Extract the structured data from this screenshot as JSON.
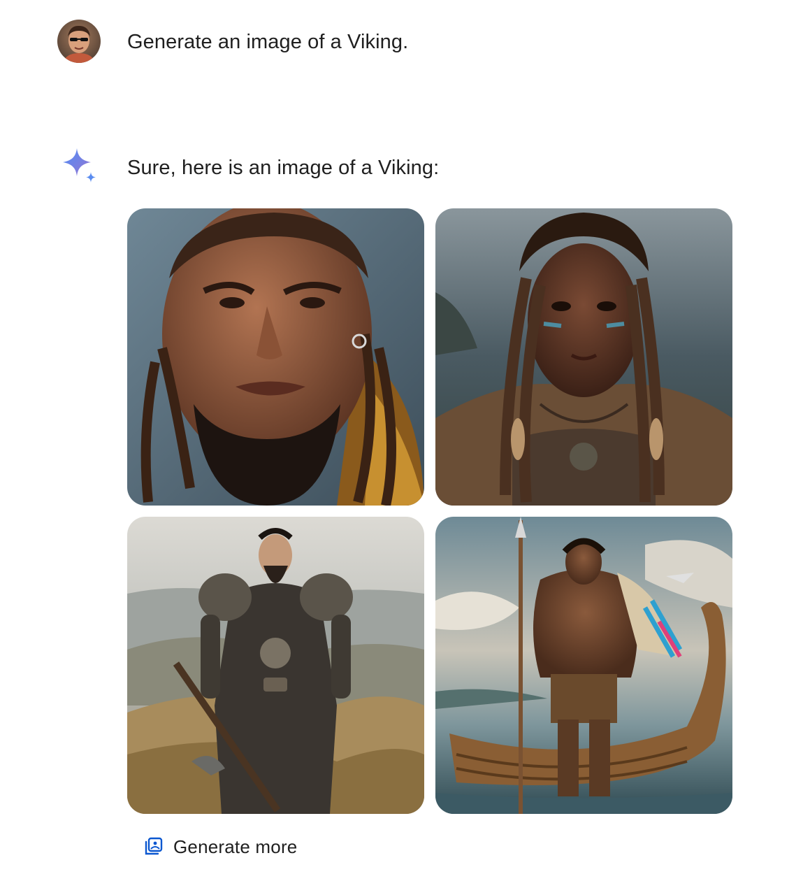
{
  "user_message": {
    "avatar_icon": "user-avatar",
    "text": "Generate an image of a Viking."
  },
  "model_response": {
    "icon": "gemini-sparkle-icon",
    "text": "Sure, here is an image of a Viking:",
    "images": [
      {
        "name": "viking-portrait-bearded-man"
      },
      {
        "name": "viking-portrait-braided-woman"
      },
      {
        "name": "viking-armored-warrior-hills"
      },
      {
        "name": "viking-spear-warrior-longship"
      }
    ],
    "generate_more": {
      "icon": "image-stack-icon",
      "label": "Generate more"
    }
  },
  "colors": {
    "accent_blue": "#0b57d0",
    "text": "#1f1f1f",
    "spark_gradient_start": "#4f8ef7",
    "spark_gradient_end": "#9b72cb"
  }
}
